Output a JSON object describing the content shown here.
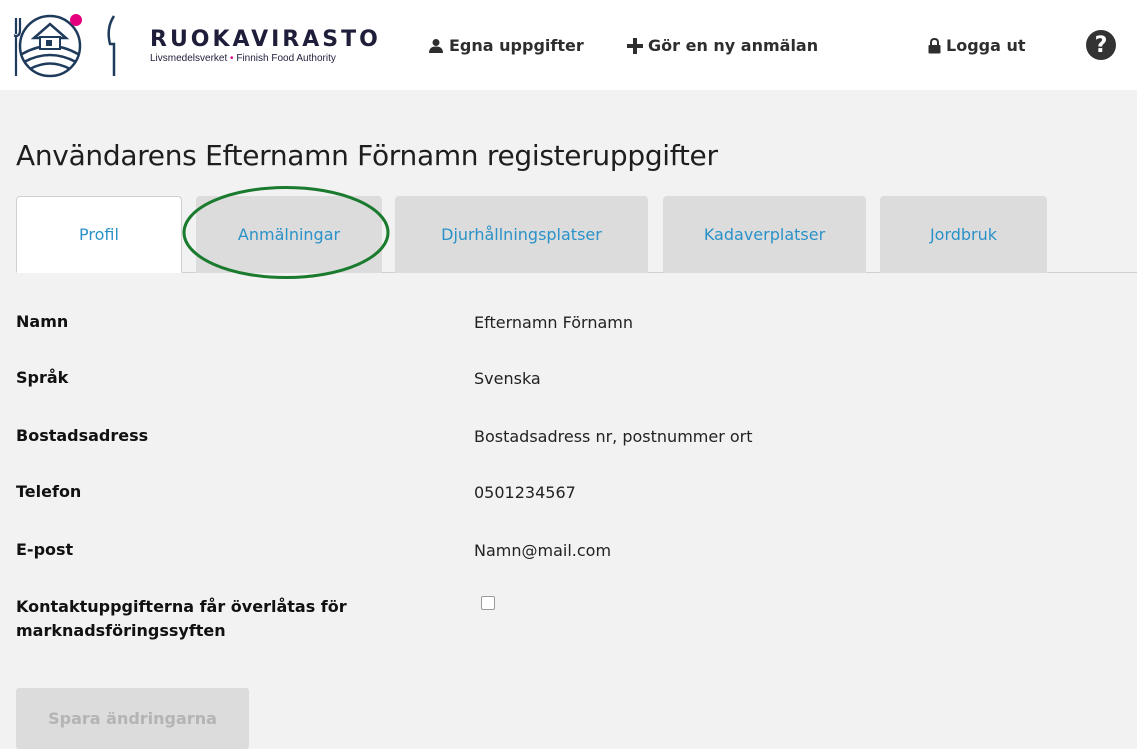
{
  "brand": {
    "name": "RUOKAVIRASTO",
    "sub_left": "Livsmedelsverket",
    "sub_dot": "•",
    "sub_right": "Finnish Food Authority",
    "accent_color": "#e5007e"
  },
  "nav": {
    "own_details": "Egna uppgifter",
    "new_notification": "Gör en ny anmälan",
    "logout": "Logga ut",
    "help": "?"
  },
  "page": {
    "title": "Användarens Efternamn Förnamn registeruppgifter"
  },
  "tabs": [
    {
      "label": "Profil",
      "active": true
    },
    {
      "label": "Anmälningar",
      "active": false,
      "highlighted": true
    },
    {
      "label": "Djurhållningsplatser",
      "active": false
    },
    {
      "label": "Kadaverplatser",
      "active": false
    },
    {
      "label": "Jordbruk",
      "active": false
    }
  ],
  "profile": {
    "name_label": "Namn",
    "name_value": "Efternamn Förnamn",
    "language_label": "Språk",
    "language_value": "Svenska",
    "address_label": "Bostadsadress",
    "address_value": "Bostadsadress nr, postnummer ort",
    "phone_label": "Telefon",
    "phone_value": "0501234567",
    "email_label": "E-post",
    "email_value": "Namn@mail.com",
    "consent_label_line1": "Kontaktuppgifterna får överlåtas för",
    "consent_label_line2": "marknadsföringssyften",
    "consent_checked": false
  },
  "actions": {
    "save_label": "Spara ändringarna"
  },
  "colors": {
    "link": "#2a92c8",
    "highlight": "#1a7a2e",
    "tab_inactive": "#dcdcdc"
  }
}
